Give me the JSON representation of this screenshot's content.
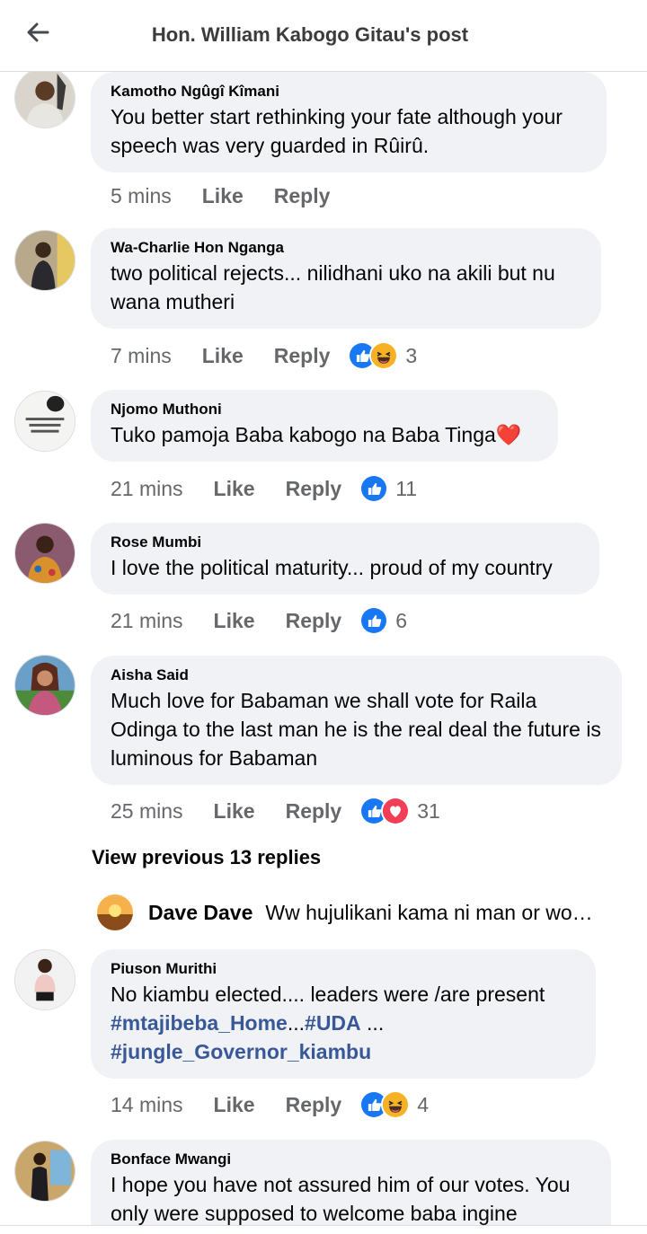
{
  "header": {
    "title": "Hon. William Kabogo Gitau's post"
  },
  "actions": {
    "like": "Like",
    "reply": "Reply"
  },
  "comments": [
    {
      "author": "Kamotho Ngûgî Kîmani",
      "text": "You better start rethinking your fate although your speech was very guarded in Rûirû.",
      "time": "5 mins",
      "reactions": [],
      "count": ""
    },
    {
      "author": "Wa-Charlie Hon Nganga",
      "text": "two political rejects... nilidhani uko na akili but nu wana mutheri",
      "time": "7 mins",
      "reactions": [
        "like-reaction-icon",
        "haha-reaction-icon"
      ],
      "count": "3"
    },
    {
      "author": "Njomo Muthoni",
      "text": "Tuko pamoja Baba kabogo na Baba Tinga❤️",
      "time": "21 mins",
      "reactions": [
        "like-reaction-icon"
      ],
      "count": "11"
    },
    {
      "author": "Rose Mumbi",
      "text": "I love the political maturity... proud of my country",
      "time": "21 mins",
      "reactions": [
        "like-reaction-icon"
      ],
      "count": "6"
    },
    {
      "author": "Aisha Said",
      "text": "Much love for Babaman we shall vote for Raila Odinga to the last man he is the real deal the future is luminous for Babaman",
      "time": "25 mins",
      "reactions": [
        "like-reaction-icon",
        "love-reaction-icon"
      ],
      "count": "31"
    },
    {
      "author": "Piuson Murithi",
      "text_start": "No kiambu elected....  leaders were /are present ",
      "hashtag1": "#mtajibeba_Home",
      "mid": "...",
      "hashtag2": "#UDA",
      "mid2": " ... ",
      "hashtag3": "#jungle_Governor_kiambu",
      "time": "14 mins",
      "reactions": [
        "like-reaction-icon",
        "haha-reaction-icon"
      ],
      "count": "4"
    },
    {
      "author": "Bonface Mwangi",
      "text": "I hope you have not assured him of our votes. You only were supposed to welcome baba ingine",
      "time": "",
      "reactions": [],
      "count": ""
    }
  ],
  "view_previous": "View previous 13 replies",
  "reply_preview": {
    "author": "Dave Dave",
    "text": "Ww hujulikani kama ni man or woman"
  },
  "colors": {
    "bubble": "#f0f2f5",
    "meta": "#65676b",
    "hashtag": "#385898",
    "like_blue": "#1877f2",
    "love_red": "#f33e58",
    "haha_yellow": "#f7b125"
  }
}
